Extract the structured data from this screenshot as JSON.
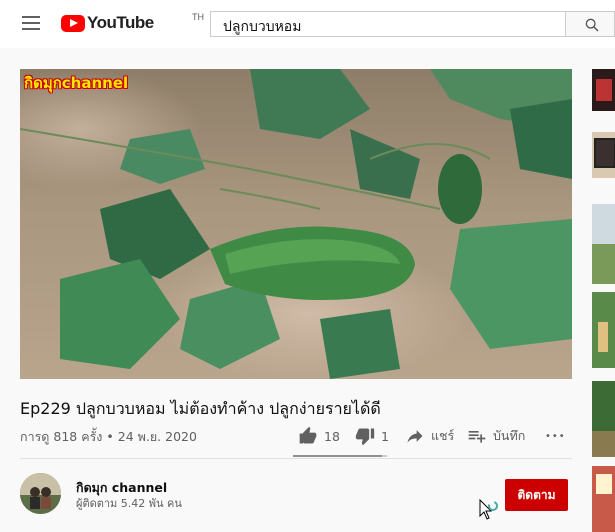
{
  "header": {
    "logo_text": "YouTube",
    "logo_region": "TH",
    "search_value": "ปลูกบวบหอม"
  },
  "video": {
    "watermark": "กิดมุกchannel",
    "title": "Ep229 ปลูกบวบหอม ไม่ต้องทำค้าง ปลูกง่ายรายได้ดี",
    "views": "การดู 818 ครั้ง",
    "separator": "•",
    "date": "24 พ.ย. 2020",
    "like_ratio": 0.95
  },
  "actions": {
    "likes": "18",
    "dislikes": "1",
    "share_label": "แชร์",
    "save_label": "บันทึก",
    "more_label": "•••"
  },
  "channel": {
    "name": "กิดมุก channel",
    "subscribers": "ผู้ติดตาม 5.42 พัน คน",
    "subscribe_label": "ติดตาม"
  },
  "colors": {
    "brand_red": "#ff0000",
    "subscribe_red": "#cc0000",
    "watermark_yellow": "#ffe600"
  }
}
